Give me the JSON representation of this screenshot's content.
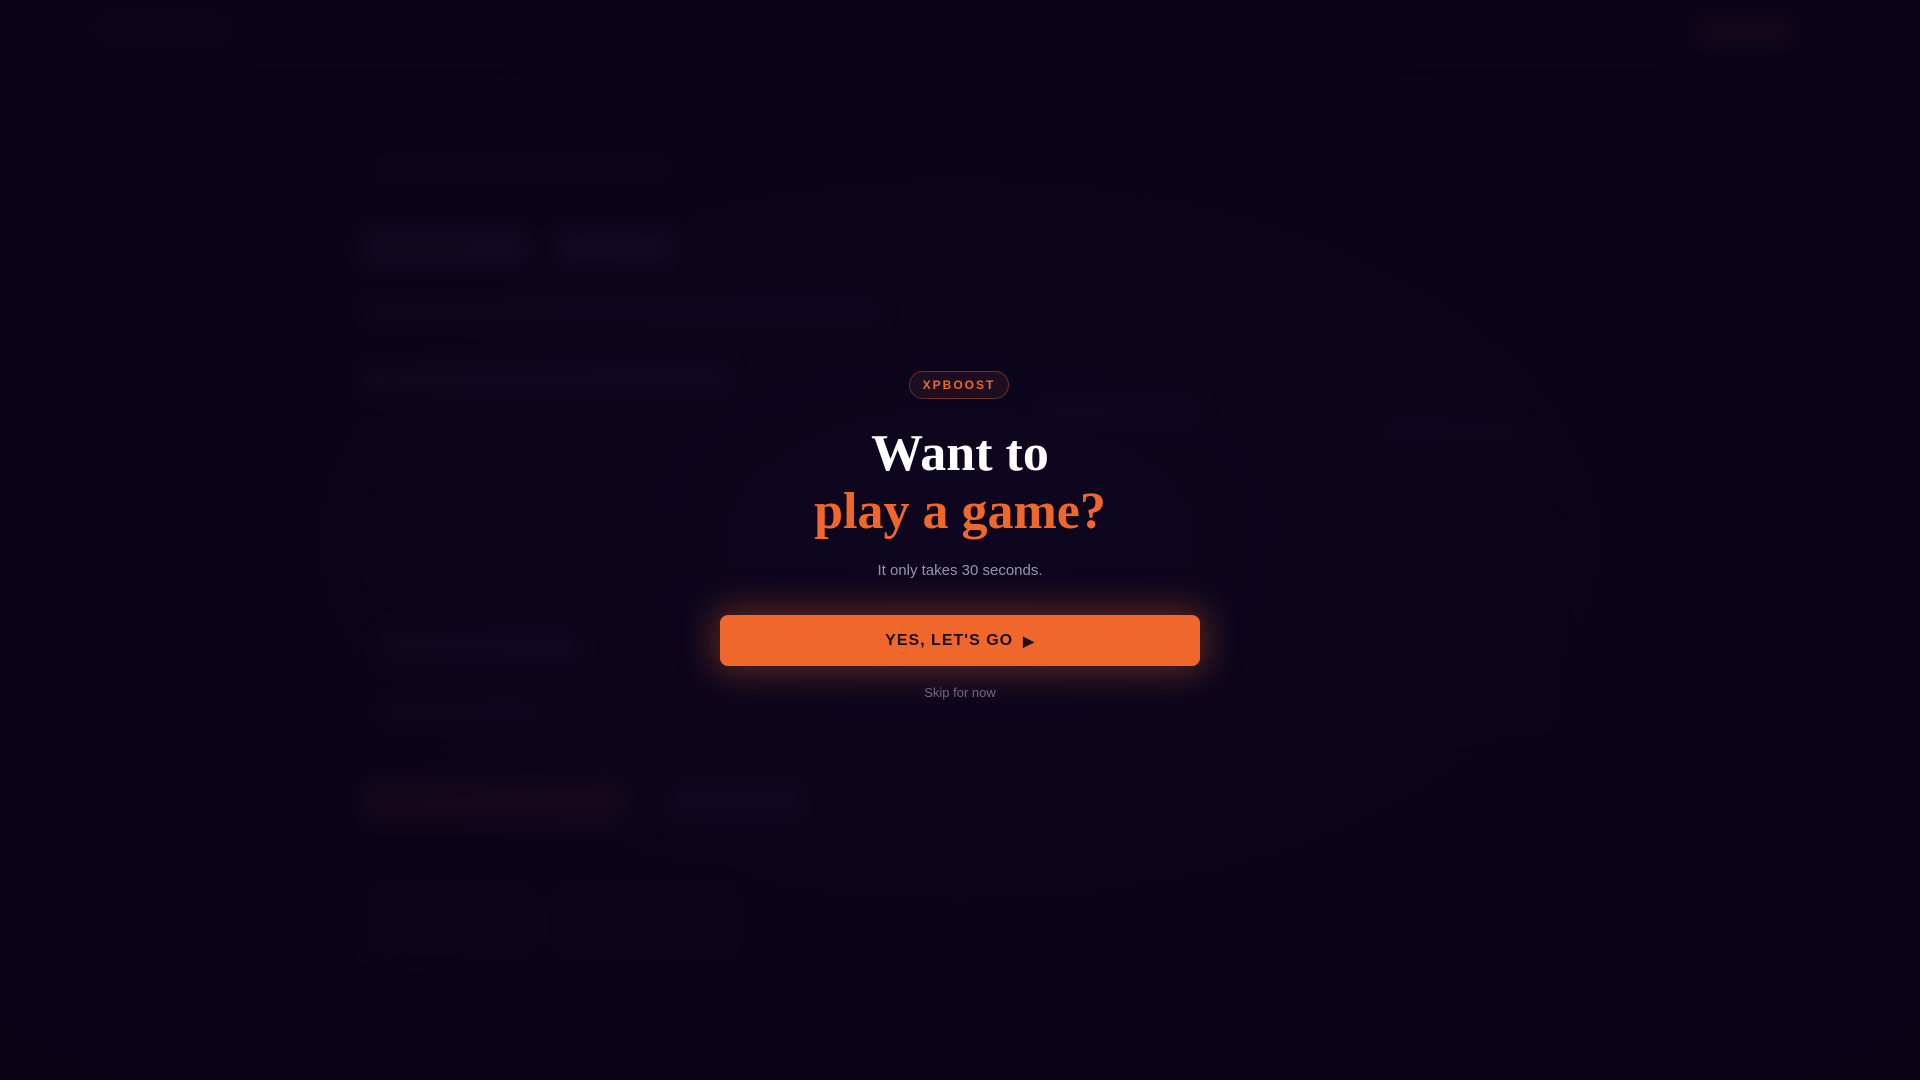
{
  "modal": {
    "badge": "XPBOOST",
    "headline_line1": "Want to",
    "headline_line2": "play a game?",
    "subtitle": "It only takes 30 seconds.",
    "cta_label": "YES, LET'S GO",
    "cta_icon": "play-icon",
    "cta_icon_glyph": "▶",
    "skip_label": "Skip for now"
  },
  "colors": {
    "background": "#0b0519",
    "accent": "#f0672b",
    "headline": "#ffffff",
    "muted": "#9a93ab"
  }
}
